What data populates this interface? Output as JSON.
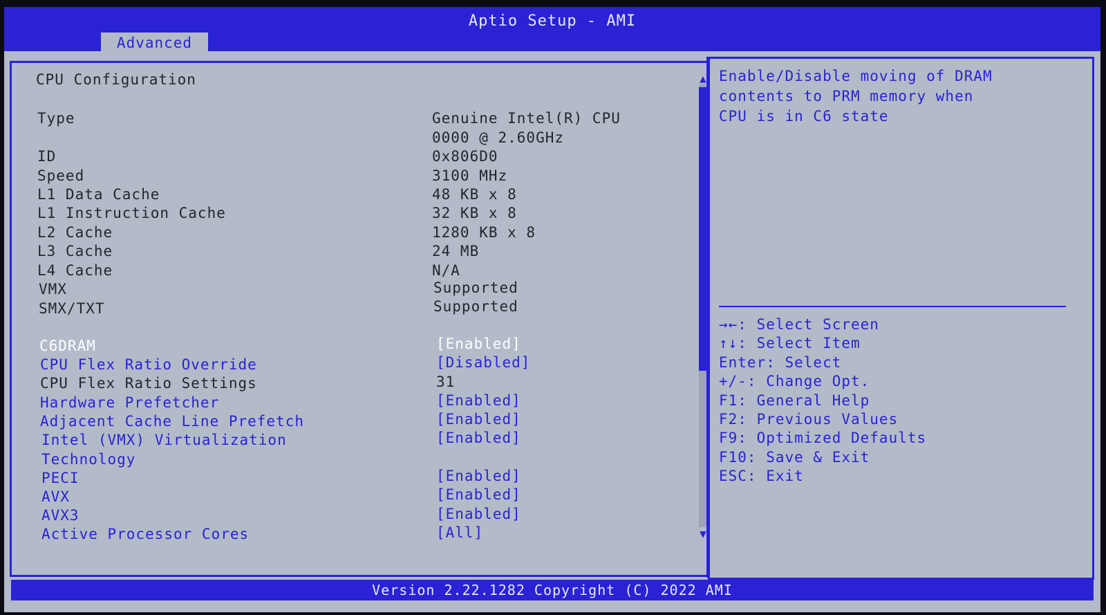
{
  "window": {
    "title": "Aptio Setup - AMI",
    "tab": "Advanced"
  },
  "page": {
    "heading": "CPU Configuration"
  },
  "info": [
    {
      "label": "Type",
      "value": "Genuine Intel(R) CPU",
      "value2": "0000 @ 2.60GHz"
    },
    {
      "label": "ID",
      "value": "0x806D0"
    },
    {
      "label": "Speed",
      "value": "3100 MHz"
    },
    {
      "label": "L1 Data Cache",
      "value": "48 KB x 8"
    },
    {
      "label": "L1 Instruction Cache",
      "value": "32 KB x 8"
    },
    {
      "label": "L2 Cache",
      "value": "1280 KB x 8"
    },
    {
      "label": "L3 Cache",
      "value": "24 MB"
    },
    {
      "label": "L4 Cache",
      "value": "N/A"
    },
    {
      "label": "VMX",
      "value": "Supported"
    },
    {
      "label": "SMX/TXT",
      "value": "Supported"
    }
  ],
  "options": [
    {
      "label": "C6DRAM",
      "value": "[Enabled]"
    },
    {
      "label": "CPU Flex Ratio Override",
      "value": "[Disabled]"
    },
    {
      "label": "CPU Flex Ratio Settings",
      "value": "31"
    },
    {
      "label": "Hardware Prefetcher",
      "value": "[Enabled]"
    },
    {
      "label": "Adjacent Cache Line Prefetch",
      "value": "[Enabled]"
    },
    {
      "label": "Intel (VMX) Virtualization",
      "label2": "Technology",
      "value": "[Enabled]"
    },
    {
      "label": "PECI",
      "value": "[Enabled]"
    },
    {
      "label": "AVX",
      "value": "[Enabled]"
    },
    {
      "label": "AVX3",
      "value": "[Enabled]"
    },
    {
      "label": "Active Processor Cores",
      "value": "[All]"
    }
  ],
  "help": {
    "lines": [
      "Enable/Disable moving of DRAM",
      "contents to PRM memory when",
      "CPU is in C6 state"
    ]
  },
  "keys": [
    "→←: Select Screen",
    "↑↓: Select Item",
    "Enter: Select",
    "+/-: Change Opt.",
    "F1: General Help",
    "F2: Previous Values",
    "F9: Optimized Defaults",
    "F10: Save & Exit",
    "ESC: Exit"
  ],
  "footer": "Version 2.22.1282 Copyright (C) 2022 AMI",
  "colors": {
    "accent": "#2a22d4",
    "background": "#b3bbc9",
    "text": "#23262e",
    "selected": "#ffffff"
  }
}
